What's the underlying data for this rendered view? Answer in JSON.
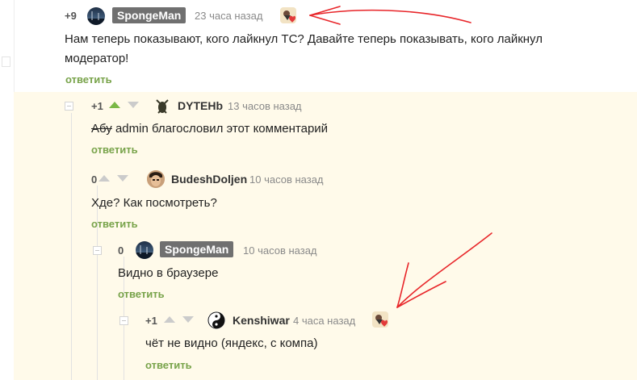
{
  "comments": [
    {
      "rating": "+9",
      "username": "SpongeMan",
      "time": "23 часа назад",
      "text_lines": [
        "Нам теперь показывают, кого лайкнул ТС? Давайте теперь показывать, кого лайкнул",
        "модератор!"
      ],
      "reply_label": "ответить"
    },
    {
      "rating": "+1",
      "username": "DYTEHb",
      "time": "13 часов назад",
      "text_struck": "Абу",
      "text_rest": " admin благословил этот комментарий",
      "reply_label": "ответить"
    },
    {
      "rating": "0",
      "username": "BudeshDoljen",
      "time": "10 часов назад",
      "text": "Хде? Как посмотреть?",
      "reply_label": "ответить"
    },
    {
      "rating": "0",
      "username": "SpongeMan",
      "time": "10 часов назад",
      "text": "Видно в браузере",
      "reply_label": "ответить"
    },
    {
      "rating": "+1",
      "username": "Kenshiwar",
      "time": "4 часа назад",
      "text": "чёт не видно (яндекс, с компа)",
      "reply_label": "ответить"
    }
  ],
  "colors": {
    "reply": "#78a34a",
    "upvote_active": "#7ab846",
    "annotation": "#e8262a",
    "thread_bg": "#fffaea"
  }
}
